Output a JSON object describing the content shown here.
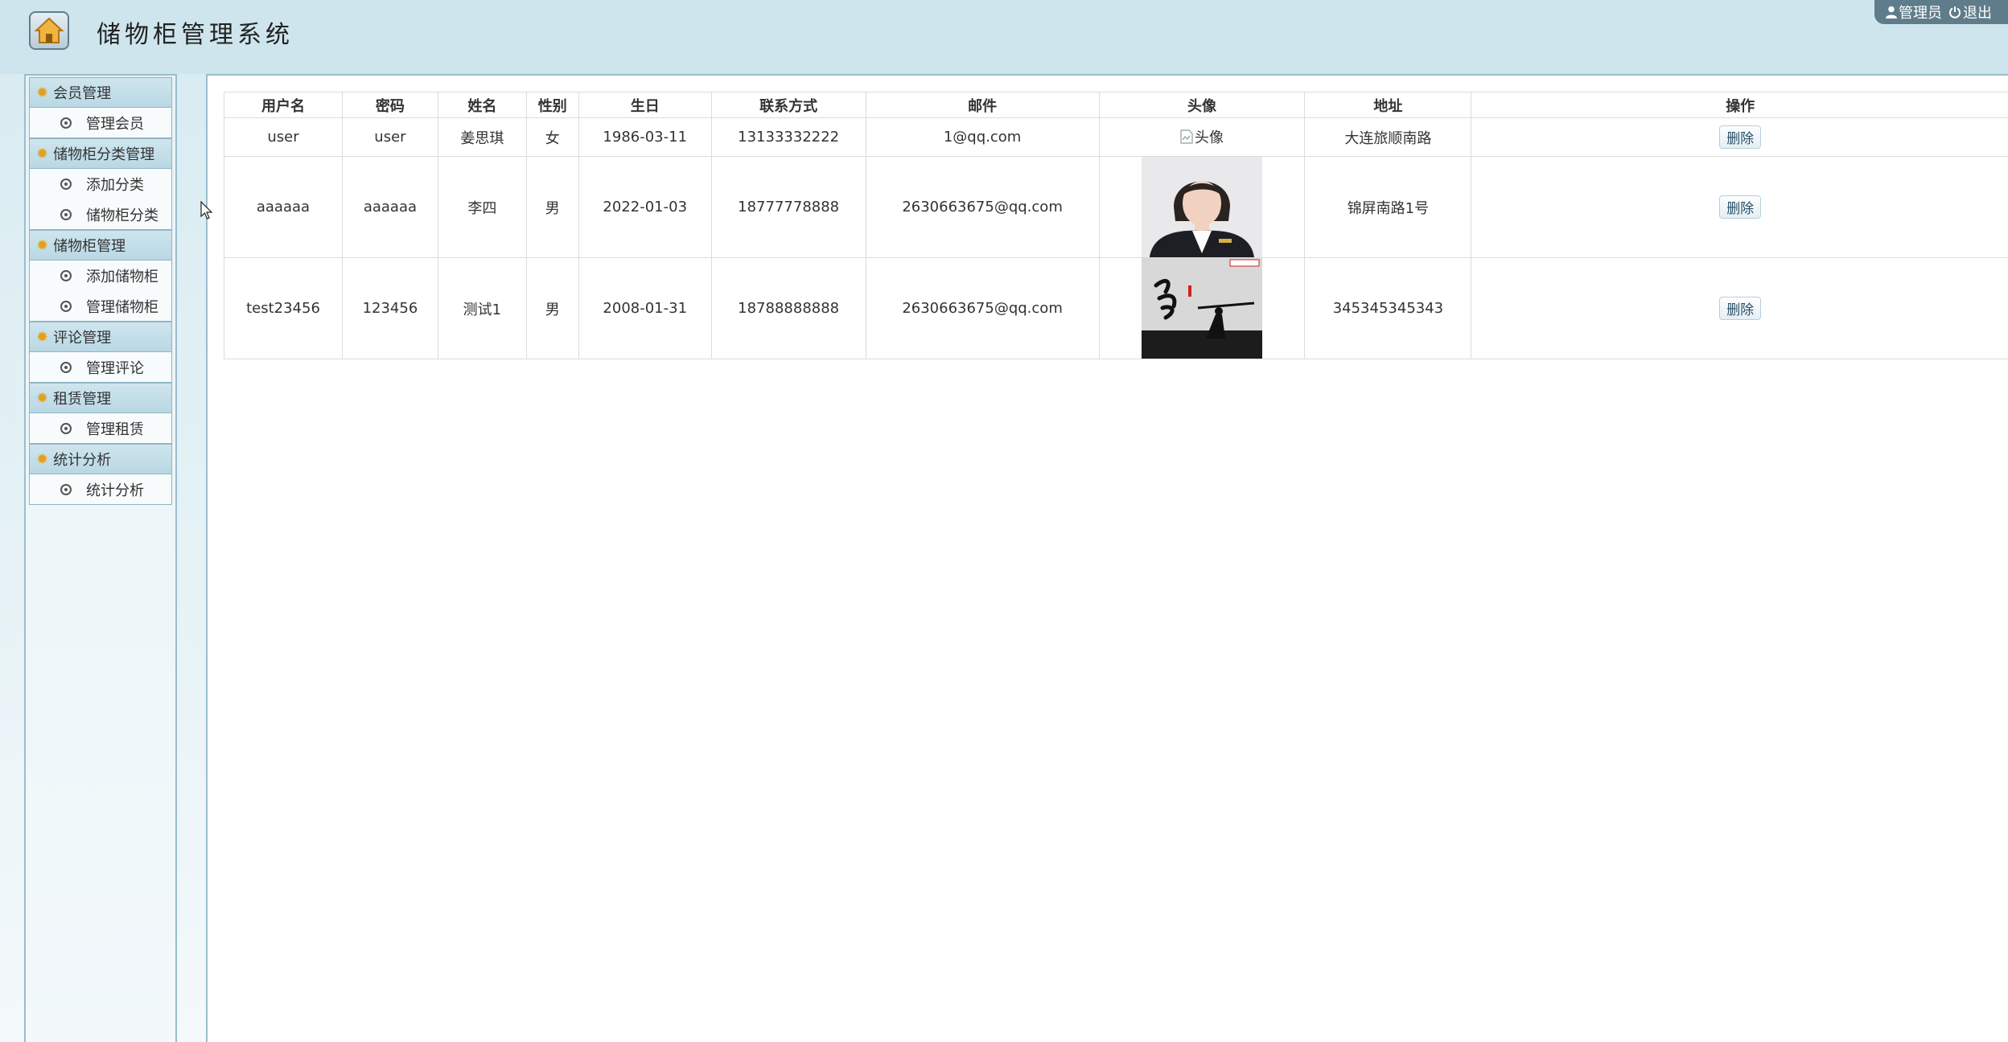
{
  "app": {
    "title": "储物柜管理系统"
  },
  "user_bar": {
    "role": "管理员",
    "logout": "退出"
  },
  "sidebar": {
    "groups": [
      {
        "label": "会员管理",
        "items": [
          "管理会员"
        ]
      },
      {
        "label": "储物柜分类管理",
        "items": [
          "添加分类",
          "储物柜分类"
        ]
      },
      {
        "label": "储物柜管理",
        "items": [
          "添加储物柜",
          "管理储物柜"
        ]
      },
      {
        "label": "评论管理",
        "items": [
          "管理评论"
        ]
      },
      {
        "label": "租赁管理",
        "items": [
          "管理租赁"
        ]
      },
      {
        "label": "统计分析",
        "items": [
          "统计分析"
        ]
      }
    ]
  },
  "table": {
    "headers": [
      "用户名",
      "密码",
      "姓名",
      "性别",
      "生日",
      "联系方式",
      "邮件",
      "头像",
      "地址",
      "操作"
    ],
    "rows": [
      {
        "username": "user",
        "password": "user",
        "name": "姜思琪",
        "gender": "女",
        "birthday": "1986-03-11",
        "phone": "13133332222",
        "email": "1@qq.com",
        "avatar_alt": "头像",
        "address": "大连旅顺南路",
        "action": "删除"
      },
      {
        "username": "aaaaaa",
        "password": "aaaaaa",
        "name": "李四",
        "gender": "男",
        "birthday": "2022-01-03",
        "phone": "18777778888",
        "email": "2630663675@qq.com",
        "avatar_alt": "",
        "address": "锦屏南路1号",
        "action": "删除"
      },
      {
        "username": "test23456",
        "password": "123456",
        "name": "测试1",
        "gender": "男",
        "birthday": "2008-01-31",
        "phone": "18788888888",
        "email": "2630663675@qq.com",
        "avatar_alt": "",
        "address": "345345345343",
        "action": "删除"
      }
    ]
  },
  "colors": {
    "header_bg": "#cfe5ed",
    "user_bar_bg": "#5f7c8a",
    "sun_icon": "#e0a020"
  }
}
